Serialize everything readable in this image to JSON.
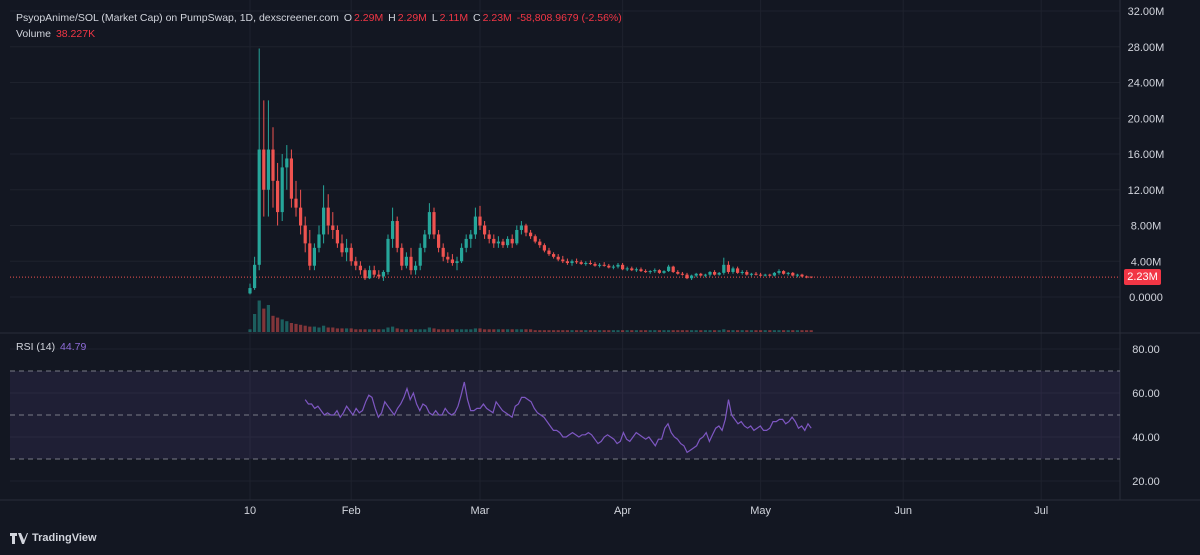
{
  "header": {
    "symbol": "PsyopAnime/SOL (Market Cap) on PumpSwap, 1D, dexscreener.com",
    "o_label": "O",
    "o_val": "2.29M",
    "h_label": "H",
    "h_val": "2.29M",
    "l_label": "L",
    "l_val": "2.11M",
    "c_label": "C",
    "c_val": "2.23M",
    "change": "-58,808.9679 (-2.56%)",
    "volume_label": "Volume",
    "volume_val": "38.227K"
  },
  "rsi": {
    "label": "RSI (14)",
    "value": "44.79"
  },
  "price_tag": "2.23M",
  "branding": "TradingView",
  "colors": {
    "bg": "#131722",
    "up": "#26a69a",
    "down": "#ef5350",
    "rsi": "#7e57c2",
    "text": "#d1d4dc"
  },
  "chart_data": {
    "type": "candlestick",
    "price_axis": {
      "min": 0,
      "max": 32000000,
      "ticks": [
        "32.00M",
        "28.00M",
        "24.00M",
        "20.00M",
        "16.00M",
        "12.00M",
        "8.00M",
        "4.00M",
        "0.0000"
      ]
    },
    "rsi_axis": {
      "min": 20,
      "max": 80,
      "ticks": [
        "80.00",
        "60.00",
        "40.00",
        "20.00"
      ],
      "bands": [
        30,
        50,
        70
      ]
    },
    "x_ticks": [
      {
        "label": "10",
        "day": 0
      },
      {
        "label": "Feb",
        "day": 22
      },
      {
        "label": "Mar",
        "day": 50
      },
      {
        "label": "Apr",
        "day": 81
      },
      {
        "label": "May",
        "day": 111
      },
      {
        "label": "Jun",
        "day": 142
      },
      {
        "label": "Jul",
        "day": 172
      }
    ],
    "last_close": 2230000,
    "candles_ohlc": [
      [
        0.4,
        1.5,
        0.3,
        1.0
      ],
      [
        1.0,
        4.5,
        0.8,
        3.6
      ],
      [
        3.6,
        27.8,
        3.0,
        16.5
      ],
      [
        16.5,
        22.0,
        9.0,
        12.0
      ],
      [
        12.0,
        22.0,
        9.0,
        16.5
      ],
      [
        16.5,
        19.0,
        10.0,
        13.0
      ],
      [
        13.0,
        15.0,
        8.0,
        9.5
      ],
      [
        9.5,
        16.0,
        8.5,
        14.5
      ],
      [
        14.5,
        17.0,
        12.0,
        15.5
      ],
      [
        15.5,
        16.5,
        10.0,
        11.0
      ],
      [
        11.0,
        13.0,
        9.0,
        10.0
      ],
      [
        10.0,
        12.0,
        7.0,
        8.0
      ],
      [
        8.0,
        9.0,
        5.0,
        6.0
      ],
      [
        6.0,
        7.5,
        3.0,
        3.5
      ],
      [
        3.5,
        6.0,
        3.0,
        5.5
      ],
      [
        5.5,
        8.0,
        5.0,
        7.0
      ],
      [
        7.0,
        12.5,
        6.0,
        10.0
      ],
      [
        10.0,
        11.5,
        7.0,
        8.0
      ],
      [
        8.0,
        9.5,
        6.5,
        7.5
      ],
      [
        7.5,
        8.0,
        5.5,
        6.0
      ],
      [
        6.0,
        7.0,
        4.5,
        5.0
      ],
      [
        5.0,
        6.5,
        4.0,
        5.5
      ],
      [
        5.5,
        6.0,
        3.5,
        4.0
      ],
      [
        4.0,
        4.5,
        3.0,
        3.5
      ],
      [
        3.5,
        4.0,
        2.5,
        3.0
      ],
      [
        3.0,
        3.2,
        1.9,
        2.1
      ],
      [
        2.1,
        3.5,
        2.0,
        3.0
      ],
      [
        3.0,
        3.5,
        2.2,
        2.5
      ],
      [
        2.5,
        3.0,
        2.0,
        2.3
      ],
      [
        2.3,
        3.0,
        1.8,
        2.8
      ],
      [
        2.8,
        7.0,
        2.5,
        6.5
      ],
      [
        6.5,
        10.0,
        5.5,
        8.5
      ],
      [
        8.5,
        9.0,
        5.0,
        5.5
      ],
      [
        5.5,
        6.0,
        3.0,
        3.5
      ],
      [
        3.5,
        5.0,
        3.2,
        4.5
      ],
      [
        4.5,
        5.5,
        2.5,
        3.0
      ],
      [
        3.0,
        4.0,
        2.5,
        3.5
      ],
      [
        3.5,
        6.0,
        3.0,
        5.5
      ],
      [
        5.5,
        7.5,
        5.0,
        7.0
      ],
      [
        7.0,
        10.5,
        6.5,
        9.5
      ],
      [
        9.5,
        10.0,
        6.5,
        7.0
      ],
      [
        7.0,
        7.5,
        5.0,
        5.5
      ],
      [
        5.5,
        6.0,
        4.0,
        4.5
      ],
      [
        4.5,
        5.0,
        3.8,
        4.2
      ],
      [
        4.2,
        4.8,
        3.5,
        3.8
      ],
      [
        3.8,
        4.5,
        3.0,
        4.0
      ],
      [
        4.0,
        6.0,
        3.8,
        5.5
      ],
      [
        5.5,
        7.0,
        5.0,
        6.5
      ],
      [
        6.5,
        7.5,
        5.5,
        7.0
      ],
      [
        7.0,
        10.0,
        6.5,
        9.0
      ],
      [
        9.0,
        10.2,
        7.5,
        8.0
      ],
      [
        8.0,
        8.5,
        6.5,
        7.0
      ],
      [
        7.0,
        7.5,
        6.0,
        6.5
      ],
      [
        6.5,
        7.0,
        5.5,
        6.0
      ],
      [
        6.0,
        6.8,
        5.5,
        6.2
      ],
      [
        6.2,
        6.5,
        5.5,
        5.8
      ],
      [
        5.8,
        6.8,
        5.5,
        6.5
      ],
      [
        6.5,
        7.0,
        5.5,
        6.0
      ],
      [
        6.0,
        8.0,
        5.8,
        7.5
      ],
      [
        7.5,
        8.5,
        7.0,
        8.0
      ],
      [
        8.0,
        8.2,
        6.8,
        7.2
      ],
      [
        7.2,
        7.5,
        6.5,
        6.8
      ],
      [
        6.8,
        7.0,
        6.0,
        6.2
      ],
      [
        6.2,
        6.5,
        5.5,
        5.8
      ],
      [
        5.8,
        6.0,
        5.0,
        5.2
      ],
      [
        5.2,
        5.5,
        4.6,
        4.8
      ],
      [
        4.8,
        5.0,
        4.3,
        4.5
      ],
      [
        4.5,
        4.8,
        4.0,
        4.2
      ],
      [
        4.2,
        4.6,
        3.8,
        4.0
      ],
      [
        4.0,
        4.3,
        3.6,
        3.8
      ],
      [
        3.8,
        4.2,
        3.5,
        4.0
      ],
      [
        4.0,
        4.3,
        3.7,
        3.9
      ],
      [
        3.9,
        4.1,
        3.6,
        3.7
      ],
      [
        3.7,
        4.0,
        3.5,
        3.8
      ],
      [
        3.8,
        4.1,
        3.6,
        3.7
      ],
      [
        3.7,
        3.9,
        3.4,
        3.5
      ],
      [
        3.5,
        3.8,
        3.3,
        3.6
      ],
      [
        3.6,
        3.9,
        3.4,
        3.5
      ],
      [
        3.5,
        3.7,
        3.2,
        3.3
      ],
      [
        3.3,
        3.6,
        3.1,
        3.4
      ],
      [
        3.4,
        3.8,
        3.2,
        3.6
      ],
      [
        3.6,
        3.8,
        3.0,
        3.1
      ],
      [
        3.1,
        3.4,
        2.9,
        3.2
      ],
      [
        3.2,
        3.4,
        2.9,
        3.0
      ],
      [
        3.0,
        3.3,
        2.8,
        3.1
      ],
      [
        3.1,
        3.3,
        2.8,
        2.9
      ],
      [
        2.9,
        3.1,
        2.7,
        2.8
      ],
      [
        2.8,
        3.0,
        2.6,
        2.9
      ],
      [
        2.9,
        3.2,
        2.7,
        3.0
      ],
      [
        3.0,
        3.1,
        2.6,
        2.7
      ],
      [
        2.7,
        3.0,
        2.6,
        2.9
      ],
      [
        2.9,
        3.6,
        2.8,
        3.4
      ],
      [
        3.4,
        3.5,
        2.7,
        2.8
      ],
      [
        2.8,
        3.0,
        2.5,
        2.6
      ],
      [
        2.6,
        2.8,
        2.4,
        2.5
      ],
      [
        2.5,
        2.7,
        2.0,
        2.1
      ],
      [
        2.1,
        2.5,
        1.9,
        2.4
      ],
      [
        2.4,
        2.7,
        2.2,
        2.6
      ],
      [
        2.6,
        2.7,
        2.3,
        2.4
      ],
      [
        2.4,
        2.6,
        2.2,
        2.5
      ],
      [
        2.5,
        2.9,
        2.3,
        2.8
      ],
      [
        2.8,
        3.0,
        2.4,
        2.5
      ],
      [
        2.5,
        2.8,
        2.4,
        2.7
      ],
      [
        2.7,
        4.4,
        2.5,
        3.6
      ],
      [
        3.6,
        4.0,
        2.6,
        2.8
      ],
      [
        2.8,
        3.4,
        2.6,
        3.2
      ],
      [
        3.2,
        3.4,
        2.6,
        2.7
      ],
      [
        2.7,
        3.0,
        2.5,
        2.8
      ],
      [
        2.8,
        3.0,
        2.4,
        2.5
      ],
      [
        2.5,
        2.7,
        2.3,
        2.6
      ],
      [
        2.6,
        2.8,
        2.4,
        2.5
      ],
      [
        2.5,
        2.7,
        2.3,
        2.4
      ],
      [
        2.4,
        2.6,
        2.3,
        2.5
      ],
      [
        2.5,
        2.6,
        2.3,
        2.4
      ],
      [
        2.4,
        2.8,
        2.3,
        2.7
      ],
      [
        2.7,
        3.1,
        2.5,
        2.9
      ],
      [
        2.9,
        3.0,
        2.5,
        2.6
      ],
      [
        2.6,
        2.8,
        2.4,
        2.7
      ],
      [
        2.7,
        2.8,
        2.3,
        2.4
      ],
      [
        2.4,
        2.6,
        2.2,
        2.5
      ],
      [
        2.5,
        2.6,
        2.2,
        2.3
      ],
      [
        2.3,
        2.4,
        2.1,
        2.2
      ],
      [
        2.29,
        2.29,
        2.11,
        2.23
      ]
    ],
    "volume": [
      0.3,
      2.0,
      3.5,
      2.6,
      3.0,
      1.8,
      1.6,
      1.4,
      1.2,
      1.0,
      0.9,
      0.8,
      0.7,
      0.6,
      0.6,
      0.5,
      0.7,
      0.5,
      0.5,
      0.4,
      0.4,
      0.4,
      0.4,
      0.3,
      0.3,
      0.3,
      0.3,
      0.3,
      0.3,
      0.3,
      0.5,
      0.6,
      0.4,
      0.3,
      0.3,
      0.3,
      0.3,
      0.3,
      0.3,
      0.5,
      0.4,
      0.3,
      0.3,
      0.3,
      0.3,
      0.3,
      0.3,
      0.3,
      0.3,
      0.4,
      0.4,
      0.3,
      0.3,
      0.3,
      0.3,
      0.3,
      0.3,
      0.3,
      0.3,
      0.3,
      0.3,
      0.3,
      0.2,
      0.2,
      0.2,
      0.2,
      0.2,
      0.2,
      0.2,
      0.2,
      0.2,
      0.2,
      0.2,
      0.2,
      0.2,
      0.2,
      0.2,
      0.2,
      0.2,
      0.2,
      0.2,
      0.2,
      0.2,
      0.2,
      0.2,
      0.2,
      0.2,
      0.2,
      0.2,
      0.2,
      0.2,
      0.2,
      0.2,
      0.2,
      0.2,
      0.2,
      0.2,
      0.2,
      0.2,
      0.2,
      0.2,
      0.2,
      0.2,
      0.3,
      0.2,
      0.2,
      0.2,
      0.2,
      0.2,
      0.2,
      0.2,
      0.2,
      0.2,
      0.2,
      0.2,
      0.2,
      0.2,
      0.2,
      0.2,
      0.2,
      0.2,
      0.2,
      0.2
    ],
    "rsi_start_day": 12,
    "rsi_values": [
      57,
      55,
      55,
      53,
      54,
      52,
      50,
      51,
      50,
      50,
      52,
      49,
      51,
      54,
      52,
      50,
      53,
      51,
      52,
      56,
      59,
      58,
      53,
      49,
      51,
      56,
      54,
      52,
      50,
      53,
      55,
      58,
      62,
      57,
      60,
      55,
      52,
      55,
      54,
      51,
      50,
      52,
      50,
      50,
      53,
      51,
      50,
      51,
      54,
      59,
      65,
      57,
      52,
      52,
      53,
      53,
      55,
      53,
      52,
      51,
      56,
      54,
      52,
      51,
      50,
      49,
      54,
      55,
      58,
      58,
      57,
      56,
      53,
      51,
      50,
      49,
      47,
      45,
      43,
      43,
      42,
      40,
      40,
      41,
      42,
      41,
      40,
      41,
      41,
      42,
      41,
      39,
      37,
      38,
      40,
      41,
      40,
      39,
      37,
      38,
      42,
      39,
      38,
      40,
      42,
      41,
      40,
      39,
      40,
      38,
      36,
      39,
      39,
      44,
      46,
      42,
      40,
      39,
      37,
      36,
      33,
      34,
      35,
      36,
      39,
      40,
      42,
      38,
      41,
      44,
      45,
      43,
      48,
      57,
      50,
      48,
      46,
      47,
      45,
      44,
      45,
      43,
      44,
      45,
      43,
      43,
      44,
      47,
      47,
      48,
      48,
      46,
      47,
      49,
      47,
      44,
      45,
      43,
      46,
      44
    ]
  }
}
